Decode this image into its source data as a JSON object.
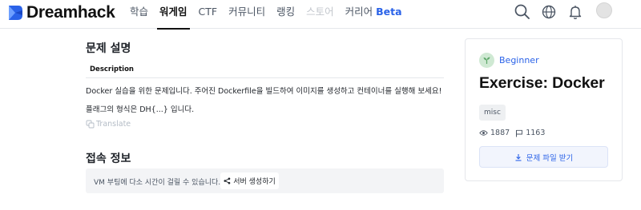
{
  "nav": {
    "logo_text": "Dreamhack",
    "menu": [
      {
        "label": "학습",
        "state": "normal"
      },
      {
        "label": "워게임",
        "state": "active"
      },
      {
        "label": "CTF",
        "state": "normal"
      },
      {
        "label": "커뮤니티",
        "state": "normal"
      },
      {
        "label": "랭킹",
        "state": "normal"
      },
      {
        "label": "스토어",
        "state": "disabled"
      },
      {
        "label": "커리어",
        "state": "normal"
      }
    ],
    "beta_label": "Beta",
    "icons": [
      "search-icon",
      "globe-icon",
      "bell-icon",
      "avatar"
    ]
  },
  "problem": {
    "heading": "문제 설명",
    "tab_label": "Description",
    "line1": "Docker 실습을 위한 문제입니다. 주어진 Dockerfile을 빌드하여 이미지를 생성하고 컨테이너를 실행해 보세요!",
    "line2": "플래그의 형식은 DH{...} 입니다.",
    "translate_label": "Translate"
  },
  "access": {
    "heading": "접속 정보",
    "vm_text": "VM 부팅에 다소 시간이 걸릴 수 있습니다.",
    "server_button": "서버 생성하기"
  },
  "card": {
    "level": "Beginner",
    "title": "Exercise: Docker",
    "tag": "misc",
    "views": "1887",
    "solves": "1163",
    "download_label": "문제 파일 받기"
  },
  "colors": {
    "accent": "#2a62e8",
    "level_badge": "#cfe9d3",
    "disabled_text": "#c3c7cd"
  }
}
